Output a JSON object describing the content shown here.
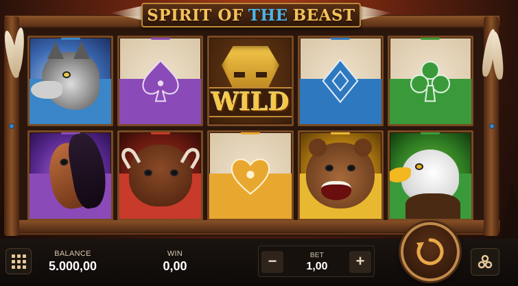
{
  "title": {
    "part1": "SPIRIT OF",
    "part2": "THE",
    "part3": "BEAST"
  },
  "reels": {
    "row1": [
      {
        "symbol": "wolf"
      },
      {
        "symbol": "spade",
        "color": "#8a4ab8"
      },
      {
        "symbol": "wild",
        "label": "WILD"
      },
      {
        "symbol": "diamond",
        "color": "#2e78c0"
      },
      {
        "symbol": "club",
        "color": "#3a9a3a"
      }
    ],
    "row2": [
      {
        "symbol": "horse"
      },
      {
        "symbol": "bison"
      },
      {
        "symbol": "heart",
        "color": "#e8a830"
      },
      {
        "symbol": "bear"
      },
      {
        "symbol": "eagle"
      }
    ]
  },
  "footer": {
    "balance_label": "BALANCE",
    "balance_value": "5.000,00",
    "win_label": "WIN",
    "win_value": "0,00",
    "bet_label": "BET",
    "bet_value": "1,00",
    "minus": "−",
    "plus": "+"
  },
  "colors": {
    "accent_gold": "#f2c25a",
    "accent_blue": "#4ab4e8",
    "frame_wood": "#6b3a1c"
  },
  "icons": {
    "menu": "grid-menu-icon",
    "spin": "spin-arrows-icon",
    "autoplay": "autoplay-icon"
  }
}
